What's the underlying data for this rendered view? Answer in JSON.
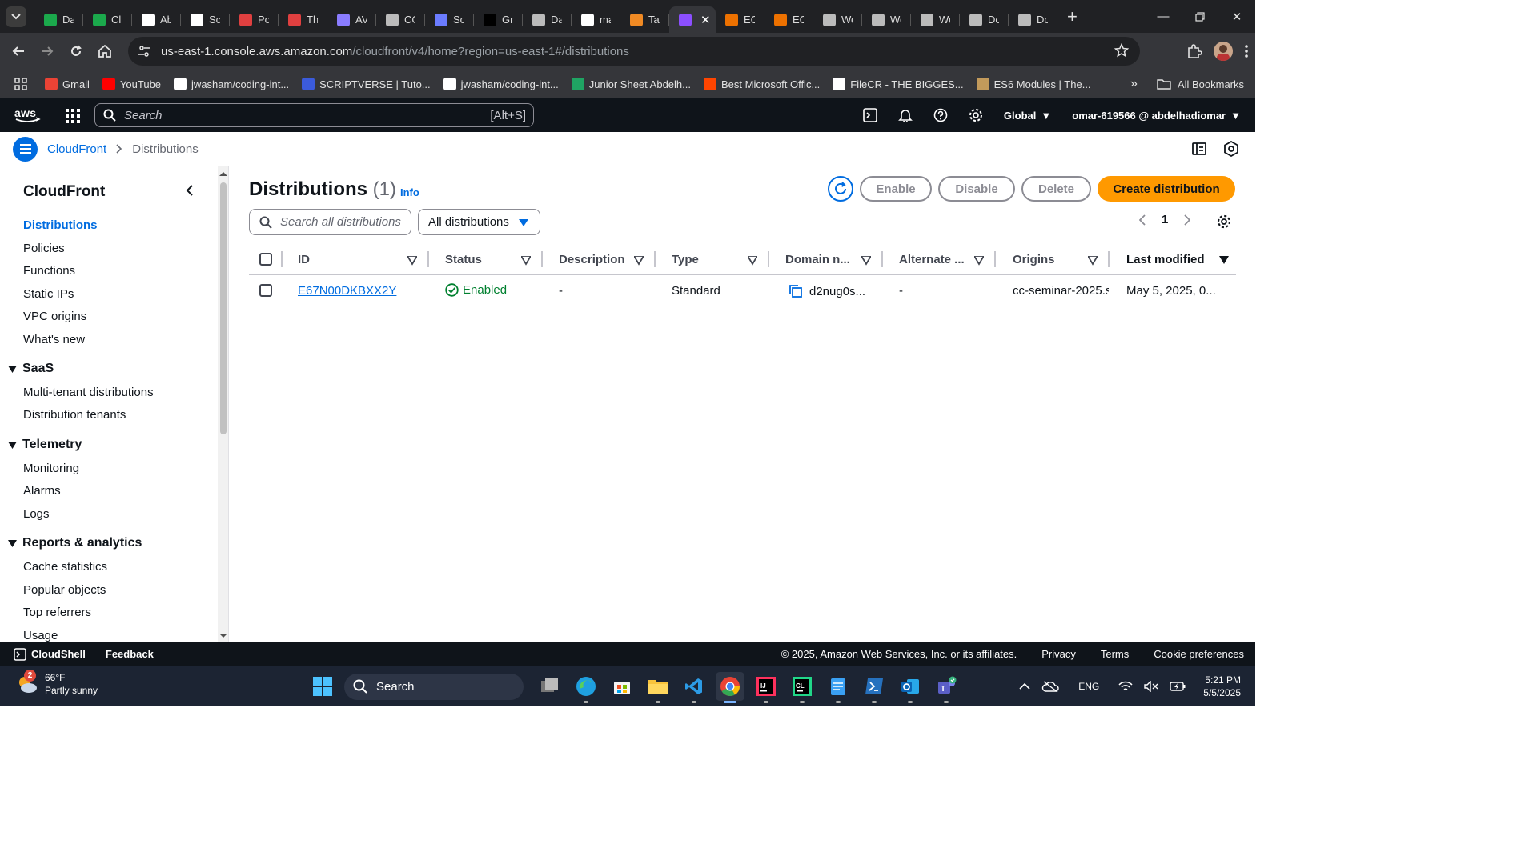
{
  "browser": {
    "tabs": [
      {
        "label": "Da",
        "icon": "hackerrank-icon",
        "color": "#1ba94c"
      },
      {
        "label": "Cli",
        "icon": "hackerrank-icon",
        "color": "#1ba94c"
      },
      {
        "label": "Ab",
        "icon": "github-icon",
        "color": "#ffffff"
      },
      {
        "label": "Sc",
        "icon": "globe-icon",
        "color": "#ffffff"
      },
      {
        "label": "Po",
        "icon": "figure-icon",
        "color": "#e04040"
      },
      {
        "label": "Th",
        "icon": "figure-icon",
        "color": "#e04040"
      },
      {
        "label": "AV",
        "icon": "cube-icon",
        "color": "#8a7cff"
      },
      {
        "label": "CC",
        "icon": "globe-icon",
        "color": "#bbbbbb"
      },
      {
        "label": "So",
        "icon": "code-icon",
        "color": "#6b7cff"
      },
      {
        "label": "Gr",
        "icon": "cursor-icon",
        "color": "#000000"
      },
      {
        "label": "Da",
        "icon": "globe-icon",
        "color": "#bbbbbb"
      },
      {
        "label": "ma",
        "icon": "github-icon",
        "color": "#ffffff"
      },
      {
        "label": "Tai",
        "icon": "orange-box-icon",
        "color": "#f08a24"
      },
      {
        "label": "",
        "icon": "cloudfront-icon",
        "color": "#8c4fff",
        "active": true
      },
      {
        "label": "EC",
        "icon": "aws-box-icon",
        "color": "#ed7100"
      },
      {
        "label": "EC",
        "icon": "aws-box-icon",
        "color": "#ed7100"
      },
      {
        "label": "We",
        "icon": "globe-icon",
        "color": "#bbbbbb"
      },
      {
        "label": "We",
        "icon": "globe-icon",
        "color": "#bbbbbb"
      },
      {
        "label": "We",
        "icon": "globe-icon",
        "color": "#bbbbbb"
      },
      {
        "label": "Do",
        "icon": "globe-icon",
        "color": "#bbbbbb"
      },
      {
        "label": "Do",
        "icon": "globe-icon",
        "color": "#bbbbbb"
      }
    ],
    "url_host": "us-east-1.console.aws.amazon.com",
    "url_path": "/cloudfront/v4/home?region=us-east-1#/distributions",
    "bookmarks": [
      {
        "label": "Gmail",
        "icon": "gmail-icon",
        "color": "#ea4335"
      },
      {
        "label": "YouTube",
        "icon": "youtube-icon",
        "color": "#ff0000"
      },
      {
        "label": "jwasham/coding-int...",
        "icon": "github-icon",
        "color": "#ffffff"
      },
      {
        "label": "SCRIPTVERSE | Tuto...",
        "icon": "scriptverse-icon",
        "color": "#3b5bdb"
      },
      {
        "label": "jwasham/coding-int...",
        "icon": "github-icon",
        "color": "#ffffff"
      },
      {
        "label": "Junior Sheet Abdelh...",
        "icon": "sheet-icon",
        "color": "#1fa463"
      },
      {
        "label": "Best Microsoft Offic...",
        "icon": "reddit-icon",
        "color": "#ff4500"
      },
      {
        "label": "FileCR - THE BIGGES...",
        "icon": "globe-icon",
        "color": "#ffffff"
      },
      {
        "label": "ES6 Modules | The...",
        "icon": "es6-icon",
        "color": "#c29a5b"
      }
    ],
    "all_bookmarks": "All Bookmarks"
  },
  "aws_nav": {
    "search_placeholder": "Search",
    "search_shortcut": "[Alt+S]",
    "region": "Global",
    "account": "omar-619566 @ abdelhadiomar"
  },
  "breadcrumb": {
    "service": "CloudFront",
    "current": "Distributions"
  },
  "sidenav": {
    "title": "CloudFront",
    "items": [
      "Distributions",
      "Policies",
      "Functions",
      "Static IPs",
      "VPC origins",
      "What's new"
    ],
    "sections": [
      {
        "title": "SaaS",
        "items": [
          "Multi-tenant distributions",
          "Distribution tenants"
        ]
      },
      {
        "title": "Telemetry",
        "items": [
          "Monitoring",
          "Alarms",
          "Logs"
        ]
      },
      {
        "title": "Reports & analytics",
        "items": [
          "Cache statistics",
          "Popular objects",
          "Top referrers",
          "Usage"
        ]
      }
    ]
  },
  "main": {
    "title": "Distributions",
    "count": "(1)",
    "info": "Info",
    "buttons": {
      "enable": "Enable",
      "disable": "Disable",
      "delete": "Delete",
      "create": "Create distribution"
    },
    "search_placeholder": "Search all distributions",
    "filter_value": "All distributions",
    "page": "1",
    "columns": [
      "ID",
      "Status",
      "Description",
      "Type",
      "Domain n...",
      "Alternate ...",
      "Origins",
      "Last modified"
    ],
    "rows": [
      {
        "id": "E67N00DKBXX2Y",
        "status": "Enabled",
        "description": "-",
        "type": "Standard",
        "domain": "d2nug0s...",
        "alternate": "-",
        "origins": "cc-seminar-2025.s",
        "last_modified": "May 5, 2025, 0..."
      }
    ]
  },
  "footer": {
    "cloudshell": "CloudShell",
    "feedback": "Feedback",
    "copyright": "© 2025, Amazon Web Services, Inc. or its affiliates.",
    "links": [
      "Privacy",
      "Terms",
      "Cookie preferences"
    ]
  },
  "taskbar": {
    "weather_temp": "66°F",
    "weather_desc": "Partly sunny",
    "weather_badge": "2",
    "search": "Search",
    "lang": "ENG",
    "time": "5:21 PM",
    "date": "5/5/2025"
  },
  "colors": {
    "aws_orange": "#ff9900",
    "aws_blue": "#006ce0",
    "status_green": "#00802f",
    "aws_dark": "#0f141a"
  }
}
